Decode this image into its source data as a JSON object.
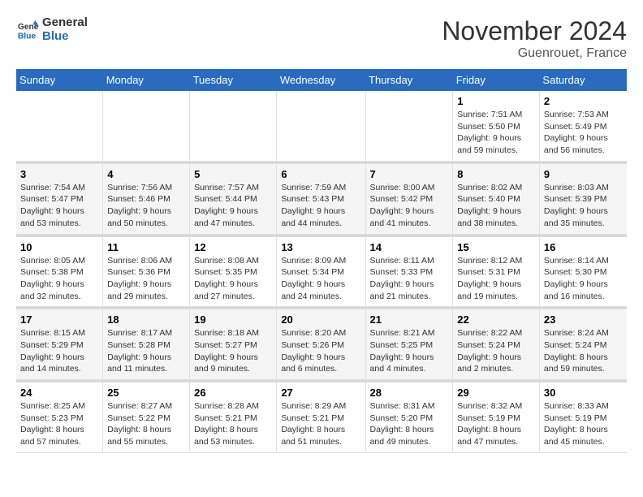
{
  "header": {
    "logo_line1": "General",
    "logo_line2": "Blue",
    "month": "November 2024",
    "location": "Guenrouet, France"
  },
  "weekdays": [
    "Sunday",
    "Monday",
    "Tuesday",
    "Wednesday",
    "Thursday",
    "Friday",
    "Saturday"
  ],
  "weeks": [
    [
      {
        "day": "",
        "info": ""
      },
      {
        "day": "",
        "info": ""
      },
      {
        "day": "",
        "info": ""
      },
      {
        "day": "",
        "info": ""
      },
      {
        "day": "",
        "info": ""
      },
      {
        "day": "1",
        "info": "Sunrise: 7:51 AM\nSunset: 5:50 PM\nDaylight: 9 hours and 59 minutes."
      },
      {
        "day": "2",
        "info": "Sunrise: 7:53 AM\nSunset: 5:49 PM\nDaylight: 9 hours and 56 minutes."
      }
    ],
    [
      {
        "day": "3",
        "info": "Sunrise: 7:54 AM\nSunset: 5:47 PM\nDaylight: 9 hours and 53 minutes."
      },
      {
        "day": "4",
        "info": "Sunrise: 7:56 AM\nSunset: 5:46 PM\nDaylight: 9 hours and 50 minutes."
      },
      {
        "day": "5",
        "info": "Sunrise: 7:57 AM\nSunset: 5:44 PM\nDaylight: 9 hours and 47 minutes."
      },
      {
        "day": "6",
        "info": "Sunrise: 7:59 AM\nSunset: 5:43 PM\nDaylight: 9 hours and 44 minutes."
      },
      {
        "day": "7",
        "info": "Sunrise: 8:00 AM\nSunset: 5:42 PM\nDaylight: 9 hours and 41 minutes."
      },
      {
        "day": "8",
        "info": "Sunrise: 8:02 AM\nSunset: 5:40 PM\nDaylight: 9 hours and 38 minutes."
      },
      {
        "day": "9",
        "info": "Sunrise: 8:03 AM\nSunset: 5:39 PM\nDaylight: 9 hours and 35 minutes."
      }
    ],
    [
      {
        "day": "10",
        "info": "Sunrise: 8:05 AM\nSunset: 5:38 PM\nDaylight: 9 hours and 32 minutes."
      },
      {
        "day": "11",
        "info": "Sunrise: 8:06 AM\nSunset: 5:36 PM\nDaylight: 9 hours and 29 minutes."
      },
      {
        "day": "12",
        "info": "Sunrise: 8:08 AM\nSunset: 5:35 PM\nDaylight: 9 hours and 27 minutes."
      },
      {
        "day": "13",
        "info": "Sunrise: 8:09 AM\nSunset: 5:34 PM\nDaylight: 9 hours and 24 minutes."
      },
      {
        "day": "14",
        "info": "Sunrise: 8:11 AM\nSunset: 5:33 PM\nDaylight: 9 hours and 21 minutes."
      },
      {
        "day": "15",
        "info": "Sunrise: 8:12 AM\nSunset: 5:31 PM\nDaylight: 9 hours and 19 minutes."
      },
      {
        "day": "16",
        "info": "Sunrise: 8:14 AM\nSunset: 5:30 PM\nDaylight: 9 hours and 16 minutes."
      }
    ],
    [
      {
        "day": "17",
        "info": "Sunrise: 8:15 AM\nSunset: 5:29 PM\nDaylight: 9 hours and 14 minutes."
      },
      {
        "day": "18",
        "info": "Sunrise: 8:17 AM\nSunset: 5:28 PM\nDaylight: 9 hours and 11 minutes."
      },
      {
        "day": "19",
        "info": "Sunrise: 8:18 AM\nSunset: 5:27 PM\nDaylight: 9 hours and 9 minutes."
      },
      {
        "day": "20",
        "info": "Sunrise: 8:20 AM\nSunset: 5:26 PM\nDaylight: 9 hours and 6 minutes."
      },
      {
        "day": "21",
        "info": "Sunrise: 8:21 AM\nSunset: 5:25 PM\nDaylight: 9 hours and 4 minutes."
      },
      {
        "day": "22",
        "info": "Sunrise: 8:22 AM\nSunset: 5:24 PM\nDaylight: 9 hours and 2 minutes."
      },
      {
        "day": "23",
        "info": "Sunrise: 8:24 AM\nSunset: 5:24 PM\nDaylight: 8 hours and 59 minutes."
      }
    ],
    [
      {
        "day": "24",
        "info": "Sunrise: 8:25 AM\nSunset: 5:23 PM\nDaylight: 8 hours and 57 minutes."
      },
      {
        "day": "25",
        "info": "Sunrise: 8:27 AM\nSunset: 5:22 PM\nDaylight: 8 hours and 55 minutes."
      },
      {
        "day": "26",
        "info": "Sunrise: 8:28 AM\nSunset: 5:21 PM\nDaylight: 8 hours and 53 minutes."
      },
      {
        "day": "27",
        "info": "Sunrise: 8:29 AM\nSunset: 5:21 PM\nDaylight: 8 hours and 51 minutes."
      },
      {
        "day": "28",
        "info": "Sunrise: 8:31 AM\nSunset: 5:20 PM\nDaylight: 8 hours and 49 minutes."
      },
      {
        "day": "29",
        "info": "Sunrise: 8:32 AM\nSunset: 5:19 PM\nDaylight: 8 hours and 47 minutes."
      },
      {
        "day": "30",
        "info": "Sunrise: 8:33 AM\nSunset: 5:19 PM\nDaylight: 8 hours and 45 minutes."
      }
    ]
  ]
}
